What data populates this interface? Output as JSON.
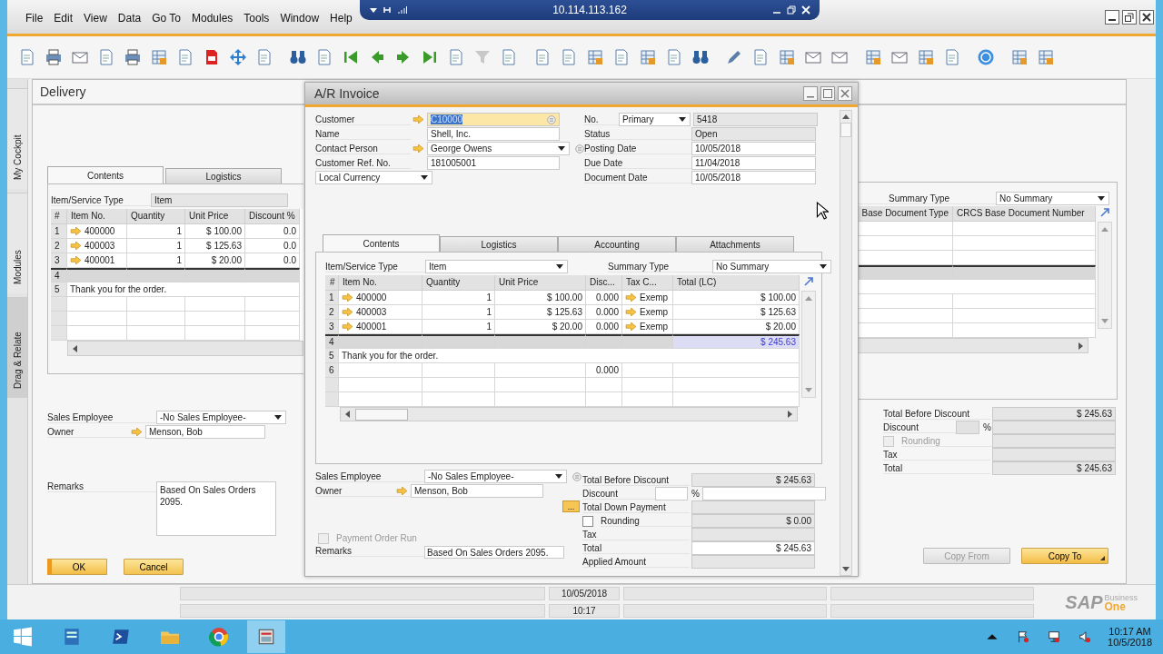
{
  "remote_bar": {
    "address": "10.114.113.162"
  },
  "menu": [
    "File",
    "Edit",
    "View",
    "Data",
    "Go To",
    "Modules",
    "Tools",
    "Window",
    "Help"
  ],
  "side_tabs": [
    {
      "label": "My Cockpit",
      "selected": false
    },
    {
      "label": "Modules",
      "selected": false
    },
    {
      "label": "Drag & Relate",
      "selected": true
    }
  ],
  "delivery": {
    "title": "Delivery",
    "tabs": [
      {
        "label": "Contents",
        "selected": true
      },
      {
        "label": "Logistics",
        "selected": false
      }
    ],
    "item_type": {
      "label": "Item/Service Type",
      "value": "Item"
    },
    "grid": {
      "columns": [
        "#",
        "Item No.",
        "Quantity",
        "Unit Price",
        "Discount %"
      ],
      "rows": [
        {
          "kind": "item",
          "cells": [
            "1",
            "400000",
            "1",
            "$ 100.00",
            "0.0"
          ]
        },
        {
          "kind": "item",
          "cells": [
            "2",
            "400003",
            "1",
            "$ 125.63",
            "0.0"
          ]
        },
        {
          "kind": "item",
          "cells": [
            "3",
            "400001",
            "1",
            "$ 20.00",
            "0.0"
          ]
        },
        {
          "kind": "total",
          "number": "4"
        },
        {
          "kind": "text",
          "number": "5",
          "text": "Thank you for the order."
        },
        {
          "kind": "empty"
        },
        {
          "kind": "empty"
        },
        {
          "kind": "empty"
        }
      ]
    },
    "sales_employee": {
      "label": "Sales Employee",
      "value": "-No Sales Employee-"
    },
    "owner": {
      "label": "Owner",
      "value": "Menson, Bob"
    },
    "remarks": {
      "label": "Remarks",
      "value": "Based On Sales Orders 2095."
    },
    "buttons": [
      {
        "label": "OK",
        "kind": "primary"
      },
      {
        "label": "Cancel",
        "kind": "normal"
      }
    ],
    "summary_type": {
      "label": "Summary Type",
      "value": "No Summary"
    },
    "right_grid": {
      "columns": [
        "Base Document Type",
        "CRCS Base Document Number"
      ],
      "rows": [
        {
          "kind": "empty"
        },
        {
          "kind": "empty"
        },
        {
          "kind": "empty"
        },
        {
          "kind": "total"
        },
        {
          "kind": "text"
        },
        {
          "kind": "empty"
        },
        {
          "kind": "empty"
        },
        {
          "kind": "empty"
        }
      ]
    },
    "totals": [
      {
        "kind": "readonly",
        "label": "Total Before Discount",
        "value": "$ 245.63"
      },
      {
        "kind": "percent",
        "label": "Discount",
        "unit": "%"
      },
      {
        "kind": "checkbox",
        "label": "Rounding",
        "checked": false,
        "disabled": true
      },
      {
        "kind": "readonly",
        "label": "Tax"
      },
      {
        "kind": "readonly",
        "label": "Total",
        "value": "$ 245.63"
      }
    ],
    "footer_buttons": [
      {
        "label": "Copy From",
        "disabled": true
      },
      {
        "label": "Copy To",
        "disabled": false
      }
    ]
  },
  "ar_invoice": {
    "title": "A/R Invoice",
    "left_fields": [
      {
        "label": "Customer",
        "value": "C10000",
        "kind": "selected",
        "link": true
      },
      {
        "label": "Name",
        "value": "Shell, Inc.",
        "kind": "text",
        "link": false
      },
      {
        "label": "Contact Person",
        "value": "George Owens",
        "kind": "dropdown",
        "link": true
      },
      {
        "label": "Customer Ref. No.",
        "value": "181005001",
        "kind": "text",
        "link": false
      }
    ],
    "currency": "Local Currency",
    "number": {
      "label": "No.",
      "series": "Primary",
      "value": "5418"
    },
    "right_fields": [
      {
        "label": "Status",
        "value": "Open",
        "kind": "readonly"
      },
      {
        "label": "Posting Date",
        "value": "10/05/2018",
        "kind": "text"
      },
      {
        "label": "Due Date",
        "value": "11/04/2018",
        "kind": "text"
      },
      {
        "label": "Document Date",
        "value": "10/05/2018",
        "kind": "text"
      }
    ],
    "tabs": [
      {
        "label": "Contents",
        "selected": true
      },
      {
        "label": "Logistics",
        "selected": false
      },
      {
        "label": "Accounting",
        "selected": false
      },
      {
        "label": "Attachments",
        "selected": false
      }
    ],
    "item_type": {
      "label": "Item/Service Type",
      "value": "Item"
    },
    "summary_type": {
      "label": "Summary Type",
      "value": "No Summary"
    },
    "grid": {
      "columns": [
        "#",
        "Item No.",
        "Quantity",
        "Unit Price",
        "Disc...",
        "Tax C...",
        "Total (LC)"
      ],
      "rows": [
        {
          "kind": "item",
          "cells": [
            "1",
            "400000",
            "1",
            "$ 100.00",
            "0.000",
            "Exemp",
            "$ 100.00"
          ]
        },
        {
          "kind": "item",
          "cells": [
            "2",
            "400003",
            "1",
            "$ 125.63",
            "0.000",
            "Exemp",
            "$ 125.63"
          ]
        },
        {
          "kind": "item",
          "cells": [
            "3",
            "400001",
            "1",
            "$ 20.00",
            "0.000",
            "Exemp",
            "$ 20.00"
          ]
        },
        {
          "kind": "total",
          "number": "4",
          "total": "$ 245.63"
        },
        {
          "kind": "text",
          "number": "5",
          "text": "Thank you for the order."
        },
        {
          "kind": "blank",
          "number": "6",
          "discount": "0.000"
        },
        {
          "kind": "empty"
        },
        {
          "kind": "empty"
        }
      ]
    },
    "sales_employee": {
      "label": "Sales Employee",
      "value": "-No Sales Employee-"
    },
    "owner": {
      "label": "Owner",
      "value": "Menson, Bob"
    },
    "payment_order_run": {
      "label": "Payment Order Run",
      "checked": false,
      "disabled": true
    },
    "remarks": {
      "label": "Remarks",
      "value": "Based On Sales Orders 2095."
    },
    "totals": [
      {
        "kind": "readonly",
        "label": "Total Before Discount",
        "value": "$ 245.63"
      },
      {
        "kind": "percent",
        "label": "Discount",
        "unit": "%"
      },
      {
        "kind": "button",
        "label": "Total Down Payment",
        "button": "..."
      },
      {
        "kind": "checkbox",
        "label": "Rounding",
        "checked": false,
        "disabled": false,
        "value": "$ 0.00"
      },
      {
        "kind": "readonly",
        "label": "Tax"
      },
      {
        "kind": "input",
        "label": "Total",
        "value": "$ 245.63"
      },
      {
        "kind": "readonly",
        "label": "Applied Amount"
      }
    ]
  },
  "status_bar": {
    "date": "10/05/2018",
    "time": "10:17"
  },
  "logo": {
    "brand": "SAP",
    "line1": "Business",
    "line2": "One"
  },
  "taskbar": {
    "time": "10:17 AM",
    "date": "10/5/2018"
  }
}
